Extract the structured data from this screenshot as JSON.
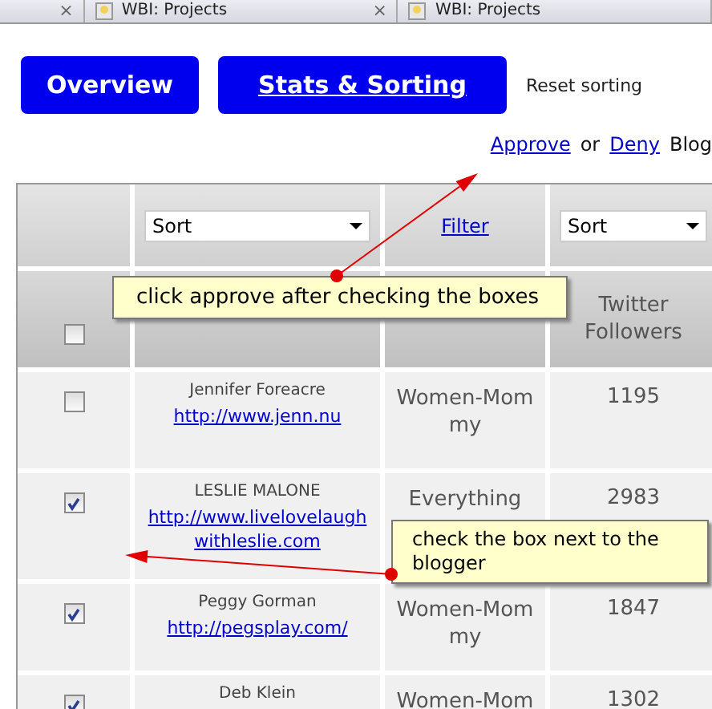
{
  "browser_tabs": [
    {
      "close": "×"
    },
    {
      "title": "WBI: Projects",
      "close": "×"
    },
    {
      "title": "WBI: Projects"
    }
  ],
  "nav_buttons": [
    {
      "label": "Overview",
      "selected": false
    },
    {
      "label": "Stats & Sorting",
      "selected": true
    }
  ],
  "reset_link": "Reset sorting",
  "actions": {
    "approve": "Approve",
    "joiner": "or",
    "deny": "Deny",
    "trailing": "Blog"
  },
  "table": {
    "sort_left": "Sort",
    "filter": "Filter",
    "sort_right": "Sort",
    "select_all_checked": false,
    "followers_heading": "Twitter Followers",
    "rows": [
      {
        "checked": false,
        "name": "Jennifer Foreacre",
        "url": "http://www.jenn.nu",
        "category": "Women-Mommy",
        "followers": "1195"
      },
      {
        "checked": true,
        "name": "LESLIE MALONE",
        "url": "http://www.livelovelaughwithleslie.com",
        "category": "Everything",
        "followers": "2983"
      },
      {
        "checked": true,
        "name": "Peggy Gorman",
        "url": "http://pegsplay.com/",
        "category": "Women-Mommy",
        "followers": "1847"
      },
      {
        "checked": true,
        "name": "Deb Klein",
        "category": "Women-Mom",
        "followers": "1302"
      }
    ]
  },
  "callouts": [
    {
      "text": "click approve after checking the boxes"
    },
    {
      "text": "check the box next to the blogger"
    }
  ]
}
